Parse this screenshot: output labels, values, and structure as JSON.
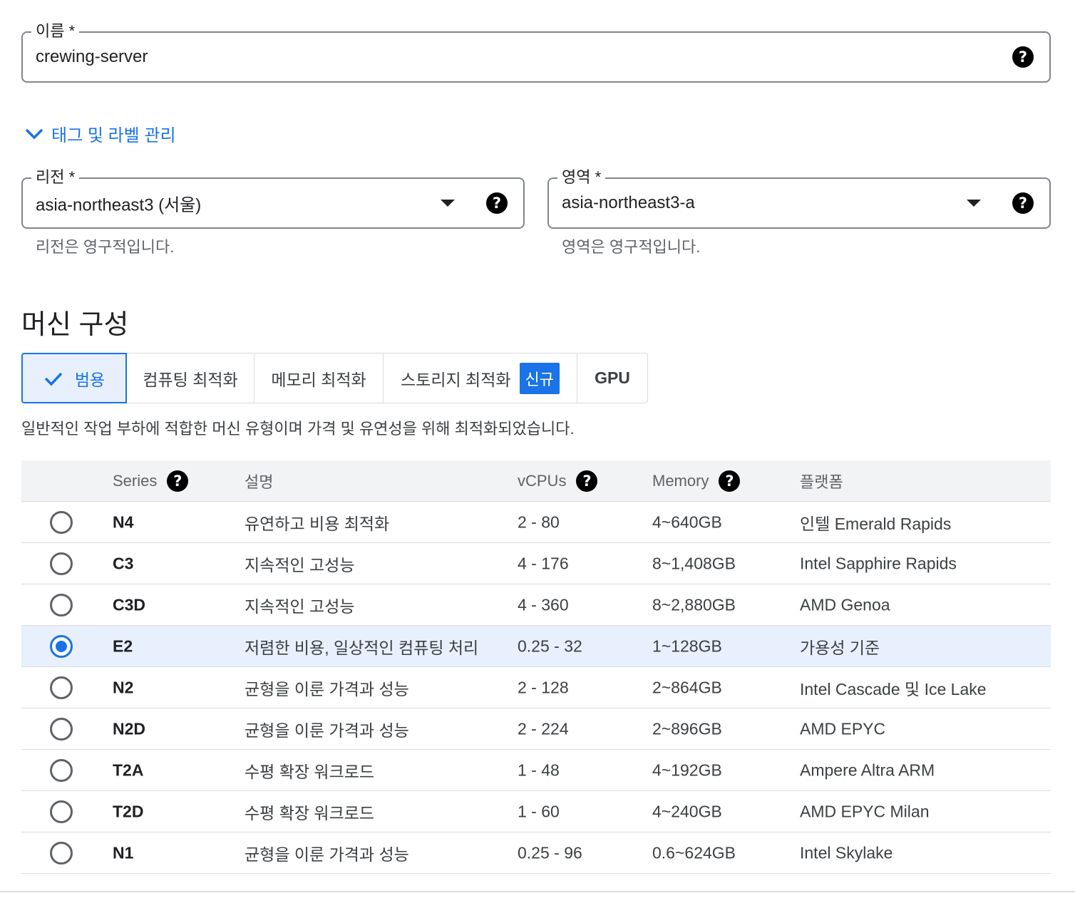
{
  "name_field": {
    "label": "이름 *",
    "value": "crewing-server"
  },
  "tags_expander": {
    "label": "태그 및 라벨 관리"
  },
  "region_field": {
    "label": "리전 *",
    "value": "asia-northeast3 (서울)",
    "hint": "리전은 영구적입니다."
  },
  "zone_field": {
    "label": "영역 *",
    "value": "asia-northeast3-a",
    "hint": "영역은 영구적입니다."
  },
  "machine_config": {
    "title": "머신 구성",
    "tabs": [
      {
        "label": "범용",
        "active": true
      },
      {
        "label": "컴퓨팅 최적화"
      },
      {
        "label": "메모리 최적화"
      },
      {
        "label": "스토리지 최적화",
        "badge": "신규"
      },
      {
        "label": "GPU"
      }
    ],
    "description": "일반적인 작업 부하에 적합한 머신 유형이며 가격 및 유연성을 위해 최적화되었습니다."
  },
  "table": {
    "headers": {
      "series": "Series",
      "description": "설명",
      "vcpus": "vCPUs",
      "memory": "Memory",
      "platform": "플랫폼"
    },
    "rows": [
      {
        "series": "N4",
        "description": "유연하고 비용 최적화",
        "vcpus": "2 - 80",
        "memory": "4~640GB",
        "platform": "인텔 Emerald Rapids",
        "selected": false
      },
      {
        "series": "C3",
        "description": "지속적인 고성능",
        "vcpus": "4 - 176",
        "memory": "8~1,408GB",
        "platform": "Intel Sapphire Rapids",
        "selected": false
      },
      {
        "series": "C3D",
        "description": "지속적인 고성능",
        "vcpus": "4 - 360",
        "memory": "8~2,880GB",
        "platform": "AMD Genoa",
        "selected": false
      },
      {
        "series": "E2",
        "description": "저렴한 비용, 일상적인 컴퓨팅 처리",
        "vcpus": "0.25 - 32",
        "memory": "1~128GB",
        "platform": "가용성 기준",
        "selected": true
      },
      {
        "series": "N2",
        "description": "균형을 이룬 가격과 성능",
        "vcpus": "2 - 128",
        "memory": "2~864GB",
        "platform": "Intel Cascade 및 Ice Lake",
        "selected": false
      },
      {
        "series": "N2D",
        "description": "균형을 이룬 가격과 성능",
        "vcpus": "2 - 224",
        "memory": "2~896GB",
        "platform": "AMD EPYC",
        "selected": false
      },
      {
        "series": "T2A",
        "description": "수평 확장 워크로드",
        "vcpus": "1 - 48",
        "memory": "4~192GB",
        "platform": "Ampere Altra ARM",
        "selected": false
      },
      {
        "series": "T2D",
        "description": "수평 확장 워크로드",
        "vcpus": "1 - 60",
        "memory": "4~240GB",
        "platform": "AMD EPYC Milan",
        "selected": false
      },
      {
        "series": "N1",
        "description": "균형을 이룬 가격과 성능",
        "vcpus": "0.25 - 96",
        "memory": "0.6~624GB",
        "platform": "Intel Skylake",
        "selected": false
      }
    ]
  },
  "colors": {
    "accent": "#1a73e8",
    "selected_row": "#e8f0fe",
    "border": "#dadce0",
    "header_bg": "#f1f3f4"
  },
  "icons": {
    "help": "help-icon",
    "dropdown": "dropdown-arrow-icon",
    "expander": "chevron-down-icon",
    "tab_check": "check-icon"
  }
}
